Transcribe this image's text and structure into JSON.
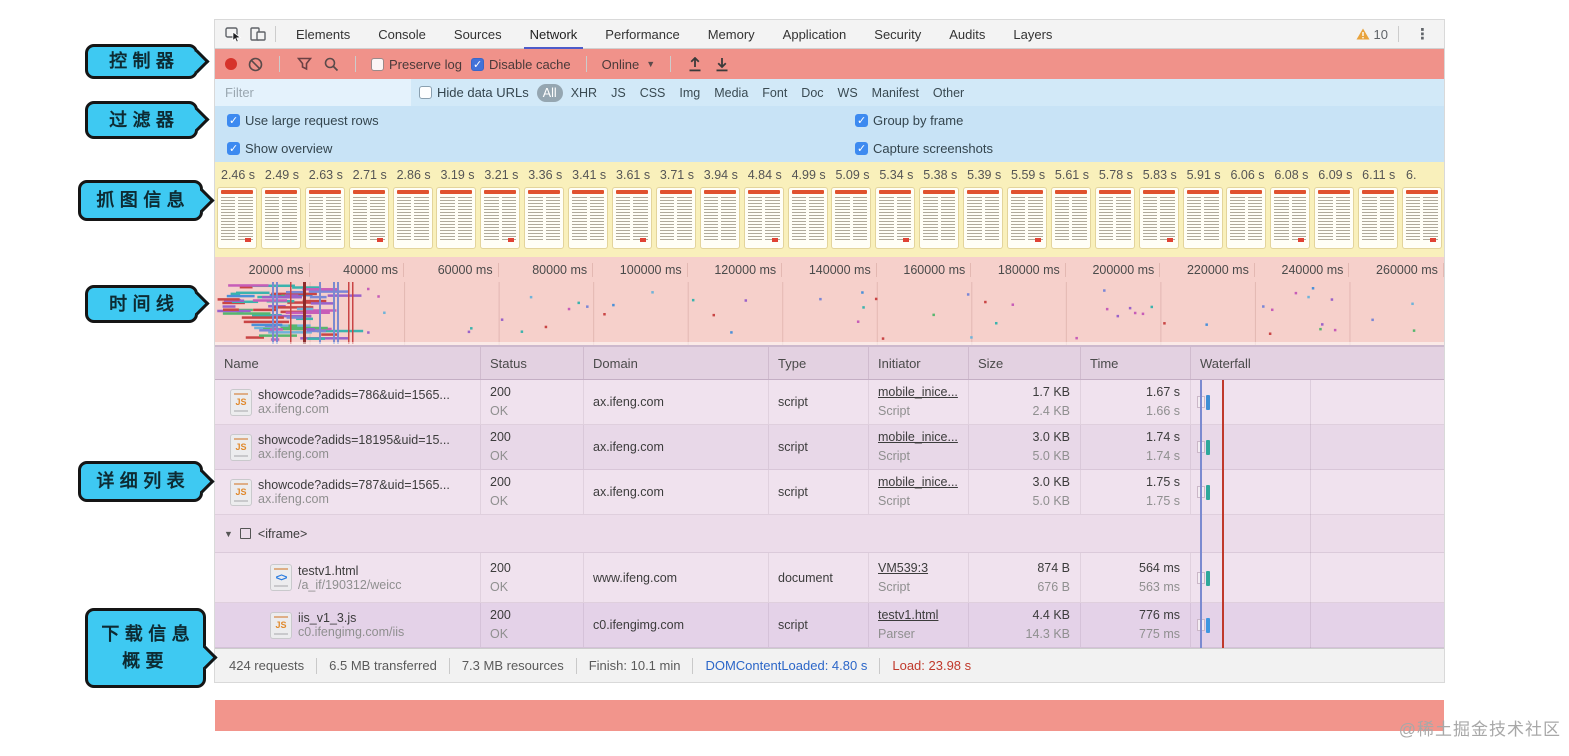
{
  "annotations": [
    {
      "label": "控制器"
    },
    {
      "label": "过滤器"
    },
    {
      "label": "抓图信息"
    },
    {
      "label": "时间线"
    },
    {
      "label": "详细列表"
    },
    {
      "label": "下载信息\n概要"
    }
  ],
  "tabbar": {
    "tabs": [
      "Elements",
      "Console",
      "Sources",
      "Network",
      "Performance",
      "Memory",
      "Application",
      "Security",
      "Audits",
      "Layers"
    ],
    "selected": "Network",
    "warning_count": "10"
  },
  "controls": {
    "preserve_log": "Preserve log",
    "disable_cache": "Disable cache",
    "throttling": "Online"
  },
  "filter": {
    "placeholder": "Filter",
    "hide_data_urls": "Hide data URLs",
    "types": [
      "All",
      "XHR",
      "JS",
      "CSS",
      "Img",
      "Media",
      "Font",
      "Doc",
      "WS",
      "Manifest",
      "Other"
    ],
    "active_type": "All"
  },
  "options": {
    "use_large_request_rows": "Use large request rows",
    "group_by_frame": "Group by frame",
    "show_overview": "Show overview",
    "capture_screenshots": "Capture screenshots"
  },
  "filmstrip": {
    "timestamps": [
      "2.46 s",
      "2.49 s",
      "2.63 s",
      "2.71 s",
      "2.86 s",
      "3.19 s",
      "3.21 s",
      "3.36 s",
      "3.41 s",
      "3.61 s",
      "3.71 s",
      "3.94 s",
      "4.84 s",
      "4.99 s",
      "5.09 s",
      "5.34 s",
      "5.38 s",
      "5.39 s",
      "5.59 s",
      "5.61 s",
      "5.78 s",
      "5.83 s",
      "5.91 s",
      "6.06 s",
      "6.08 s",
      "6.09 s",
      "6.11 s",
      "6."
    ]
  },
  "timeline": {
    "labels": [
      "20000 ms",
      "40000 ms",
      "60000 ms",
      "80000 ms",
      "100000 ms",
      "120000 ms",
      "140000 ms",
      "160000 ms",
      "180000 ms",
      "200000 ms",
      "220000 ms",
      "240000 ms",
      "260000 ms"
    ]
  },
  "table": {
    "columns": [
      "Name",
      "Status",
      "Domain",
      "Type",
      "Initiator",
      "Size",
      "Time",
      "Waterfall"
    ],
    "rows": [
      {
        "kind": "request",
        "icon": "js",
        "name": "showcode?adids=786&uid=1565...",
        "path": "ax.ifeng.com",
        "status": "200",
        "status_text": "OK",
        "domain": "ax.ifeng.com",
        "type": "script",
        "initiator": "mobile_inice...",
        "initiator_type": "Script",
        "size": "1.7 KB",
        "size_content": "2.4 KB",
        "time": "1.67 s",
        "latency": "1.66 s",
        "bar_color": "#3f8fd4"
      },
      {
        "kind": "request",
        "icon": "js",
        "name": "showcode?adids=18195&uid=15...",
        "path": "ax.ifeng.com",
        "status": "200",
        "status_text": "OK",
        "domain": "ax.ifeng.com",
        "type": "script",
        "initiator": "mobile_inice...",
        "initiator_type": "Script",
        "size": "3.0 KB",
        "size_content": "5.0 KB",
        "time": "1.74 s",
        "latency": "1.74 s",
        "bar_color": "#2fa89b"
      },
      {
        "kind": "request",
        "icon": "js",
        "name": "showcode?adids=787&uid=1565...",
        "path": "ax.ifeng.com",
        "status": "200",
        "status_text": "OK",
        "domain": "ax.ifeng.com",
        "type": "script",
        "initiator": "mobile_inice...",
        "initiator_type": "Script",
        "size": "3.0 KB",
        "size_content": "5.0 KB",
        "time": "1.75 s",
        "latency": "1.75 s",
        "bar_color": "#2fa89b"
      },
      {
        "kind": "group",
        "name": "<iframe>"
      },
      {
        "kind": "request",
        "icon": "html",
        "child": true,
        "name": "testv1.html",
        "path": "/a_if/190312/weicc",
        "status": "200",
        "status_text": "OK",
        "domain": "www.ifeng.com",
        "type": "document",
        "initiator": "VM539:3",
        "initiator_type": "Script",
        "size": "874 B",
        "size_content": "676 B",
        "time": "564 ms",
        "latency": "563 ms",
        "bar_color": "#2fa89b"
      },
      {
        "kind": "request",
        "icon": "js",
        "child": true,
        "name": "iis_v1_3.js",
        "path": "c0.ifengimg.com/iis",
        "status": "200",
        "status_text": "OK",
        "domain": "c0.ifengimg.com",
        "type": "script",
        "initiator": "testv1.html",
        "initiator_type": "Parser",
        "size": "4.4 KB",
        "size_content": "14.3 KB",
        "time": "776 ms",
        "latency": "775 ms",
        "bar_color": "#3f97e0"
      }
    ]
  },
  "statusbar": {
    "items": [
      {
        "text": "424 requests"
      },
      {
        "text": "6.5 MB transferred"
      },
      {
        "text": "7.3 MB resources"
      },
      {
        "text": "Finish: 10.1 min"
      },
      {
        "text": "DOMContentLoaded: 4.80 s",
        "style": "dcl"
      },
      {
        "text": "Load: 23.98 s",
        "style": "load"
      }
    ]
  },
  "watermark": "@稀土掘金技术社区",
  "colors": {
    "overlay_red": "#f0928a",
    "overlay_blue": "#cde6f7",
    "overlay_yellow": "#f9f0bb",
    "overlay_pink": "#f6d0cb",
    "overlay_purple": "#e9dae9",
    "callout_cyan": "#3ec9f2",
    "tab_underline": "#4d5bc9",
    "record_red": "#d6332b",
    "dcl_blue": "#2b66c8",
    "load_red": "#c0392b",
    "warning_yellow": "#e8a33d"
  }
}
